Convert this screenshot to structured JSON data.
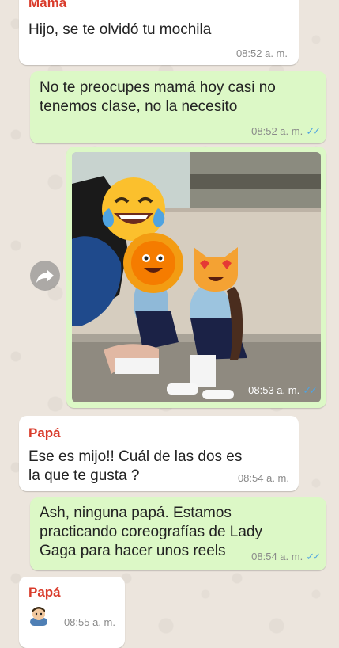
{
  "messages": {
    "m1": {
      "sender": "Mamá",
      "text": "Hijo, se te olvidó tu mochila",
      "time": "08:52 a. m."
    },
    "m2": {
      "text": "No te preocupes mamá hoy casi no tenemos clase, no la necesito",
      "time": "08:52 a. m.",
      "ticks": "✓✓"
    },
    "m3": {
      "time": "08:53 a. m.",
      "ticks": "✓✓"
    },
    "m4": {
      "sender": "Papá",
      "text": "Ese es mijo!! Cuál de las dos es la que te gusta ?",
      "time": "08:54 a. m."
    },
    "m5": {
      "text": "Ash, ninguna papá. Estamos practicando coreografías de Lady Gaga para hacer unos reels",
      "time": "08:54 a. m.",
      "ticks": "✓✓"
    },
    "m6": {
      "sender": "Papá",
      "time": "08:55 a. m."
    }
  },
  "icons": {
    "forward": "forward-arrow-icon",
    "emoji1": "laughing-tears-emoji",
    "emoji2": "sun-face-emoji",
    "emoji3": "heart-eyes-cat-emoji",
    "emoji4": "man-emoji"
  },
  "colors": {
    "incoming": "#ffffff",
    "outgoing": "#dcf8c6",
    "sender": "#d93b2b",
    "ticks": "#4fa3e0"
  }
}
